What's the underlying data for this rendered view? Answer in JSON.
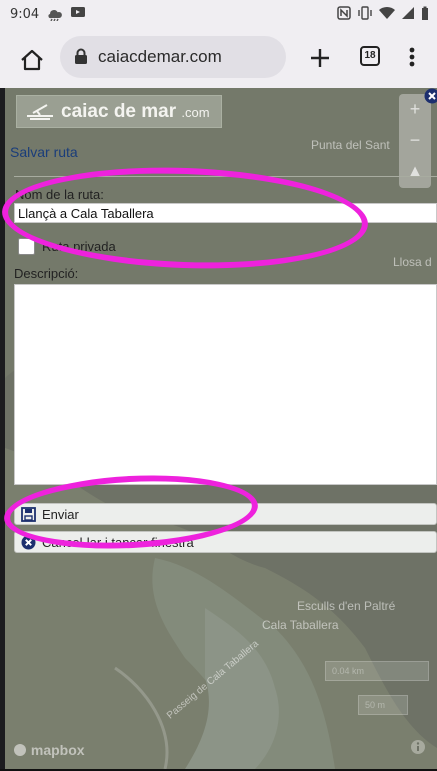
{
  "status_bar": {
    "time": "9:04",
    "icons_left": [
      "weather-icon",
      "notification-icon"
    ],
    "icons_right": [
      "nfc-icon",
      "vibrate-icon",
      "wifi-icon",
      "signal-icon",
      "battery-icon"
    ]
  },
  "browser": {
    "url": "caiacdemar.com",
    "tab_count": "18"
  },
  "form": {
    "logo_text": "caiac de mar",
    "logo_suffix": ".com",
    "title": "Salvar ruta",
    "name_label": "Nom de la ruta:",
    "name_value": "Llançà a Cala Taballera",
    "private_label": "Ruta privada",
    "private_checked": false,
    "desc_label": "Descripció:",
    "desc_value": "",
    "send_label": "Enviar",
    "cancel_label": "Cancel·lar i tancar finestra"
  },
  "map": {
    "labels": [
      "Punta del Sant",
      "Llosa d",
      "Esculls d'en Paltré",
      "Cala Taballera",
      "Passeig de Cala Taballera"
    ],
    "attribution": "mapbox",
    "scale_1": "0.04 km",
    "scale_2": "50 m"
  },
  "annotations": {
    "color": "#ee22dd"
  },
  "colors": {
    "title": "#1a3d7a",
    "chrome": "#f0eef2",
    "cancel_icon": "#1c2f6e"
  }
}
